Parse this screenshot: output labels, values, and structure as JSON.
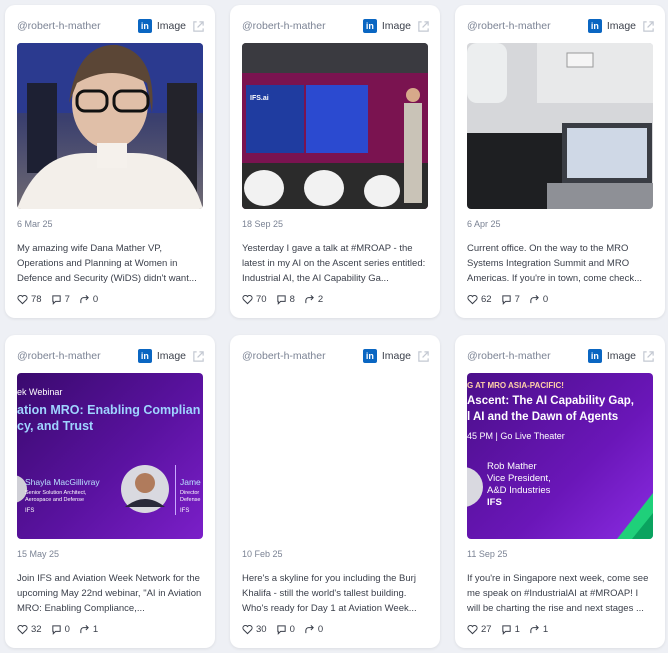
{
  "posts": [
    {
      "handle": "@robert-h-mather",
      "network_badge": "in",
      "type": "Image",
      "date": "6 Mar 25",
      "text": "My amazing wife Dana Mather VP, Operations and Planning at Women in Defence and Security (WiDS) didn't want...",
      "likes": "78",
      "comments": "7",
      "shares": "0"
    },
    {
      "handle": "@robert-h-mather",
      "network_badge": "in",
      "type": "Image",
      "date": "18 Sep 25",
      "text": "Yesterday I gave a talk at #MROAP - the latest in my AI on the Ascent series entitled: Industrial AI, the AI Capability Ga...",
      "likes": "70",
      "comments": "8",
      "shares": "2",
      "image_text": "IFS.ai"
    },
    {
      "handle": "@robert-h-mather",
      "network_badge": "in",
      "type": "Image",
      "date": "6 Apr 25",
      "text": "Current office. On the way to the MRO Systems Integration Summit and MRO Americas. If you're in town, come check...",
      "likes": "62",
      "comments": "7",
      "shares": "0"
    },
    {
      "handle": "@robert-h-mather",
      "network_badge": "in",
      "type": "Image",
      "date": "15 May 25",
      "text": "Join IFS and Aviation Week Network for the upcoming May 22nd webinar, \"AI in Aviation MRO: Enabling Compliance,...",
      "likes": "32",
      "comments": "0",
      "shares": "1",
      "image": {
        "kicker": "ek Webinar",
        "headline1": "ation MRO: Enabling Complian",
        "headline2": "cy, and Trust",
        "speaker1_name": "Shayla MacGillivray",
        "speaker1_role1": "Senior Solution Architect,",
        "speaker1_role2": "Aerospace and Defense",
        "speaker1_org": "IFS",
        "speaker2_name": "Jame",
        "speaker2_role1": "Director",
        "speaker2_role2": "Defense",
        "speaker2_org": "IFS"
      }
    },
    {
      "handle": "@robert-h-mather",
      "network_badge": "in",
      "type": "Image",
      "date": "10 Feb 25",
      "text": "Here's a skyline for you including the Burj Khalifa - still the world's tallest building. Who's ready for Day 1 at Aviation Week...",
      "likes": "30",
      "comments": "0",
      "shares": "0"
    },
    {
      "handle": "@robert-h-mather",
      "network_badge": "in",
      "type": "Image",
      "date": "11 Sep 25",
      "text": "If you're in Singapore next week, come see me speak on #IndustrialAI at #MROAP! I will be charting the rise and next stages ...",
      "likes": "27",
      "comments": "1",
      "shares": "1",
      "image": {
        "kicker": "G AT MRO ASIA-PACIFIC!",
        "headline1": "Ascent: The AI Capability Gap,",
        "headline2": "l AI and the Dawn of Agents",
        "time": "45 PM | Go Live Theater",
        "speaker_name": "Rob Mather",
        "speaker_role1": "Vice President,",
        "speaker_role2": "A&D Industries",
        "speaker_org": "IFS"
      }
    }
  ],
  "colors": {
    "linkedin": "#0a66c2",
    "card_bg": "#ffffff",
    "page_bg": "#eef0f5"
  }
}
